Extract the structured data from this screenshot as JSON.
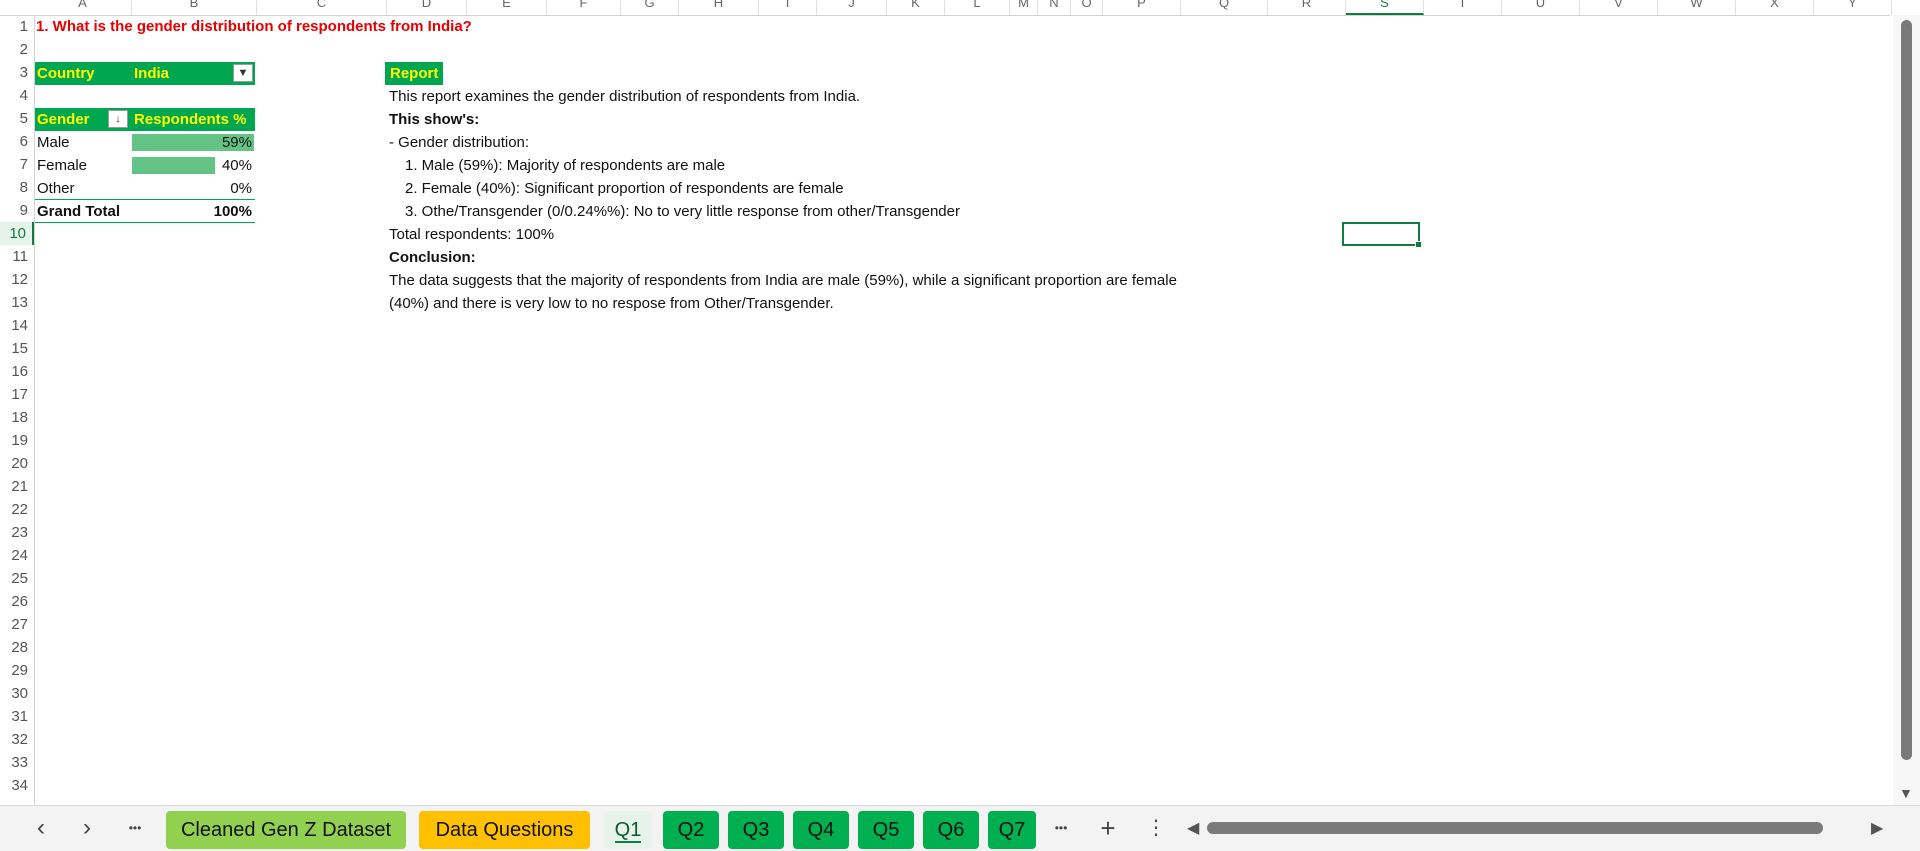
{
  "columns": [
    "A",
    "B",
    "C",
    "D",
    "E",
    "F",
    "G",
    "H",
    "I",
    "J",
    "K",
    "L",
    "M",
    "N",
    "O",
    "P",
    "Q",
    "R",
    "S",
    "T",
    "U",
    "V",
    "W",
    "X",
    "Y"
  ],
  "selected_column": "S",
  "rows": [
    "1",
    "2",
    "3",
    "4",
    "5",
    "6",
    "7",
    "8",
    "9",
    "10",
    "11",
    "12",
    "13",
    "14",
    "15",
    "16",
    "17",
    "18",
    "19",
    "20",
    "21",
    "22",
    "23",
    "24",
    "25",
    "26",
    "27",
    "28",
    "29",
    "30",
    "31",
    "32",
    "33",
    "34"
  ],
  "selected_row": "10",
  "sheet": {
    "question": "1. What is the gender distribution of respondents from India?",
    "filter": {
      "label": "Country",
      "value": "India"
    },
    "pivot": {
      "header_gender": "Gender",
      "header_pct": "Respondents %",
      "rows": [
        {
          "label": "Male",
          "value": "59%",
          "fill": 0.59
        },
        {
          "label": "Female",
          "value": "40%",
          "fill": 0.4
        },
        {
          "label": "Other",
          "value": "0%",
          "fill": 0
        }
      ],
      "total_label": "Grand Total",
      "total_value": "100%"
    },
    "report": {
      "title": "Report",
      "line1": "This report examines the gender distribution of respondents from India.",
      "shows_heading": "This show's:",
      "dist_heading": "- Gender distribution:",
      "item1": "1. Male (59%): Majority of respondents are male",
      "item2": "2. Female (40%): Significant proportion of respondents are female",
      "item3": "3. Othe/Transgender (0/0.24%%): No to very little response from other/Transgender",
      "total": "Total respondents: 100%",
      "conclusion_heading": "Conclusion:",
      "conclusion_line1": "The data suggests that the majority of respondents from India are male (59%), while a significant proportion are female",
      "conclusion_line2": "(40%) and there is very low to no respose from Other/Transgender."
    }
  },
  "tabs": {
    "prev": "‹",
    "next": "›",
    "more_left": "•••",
    "sheets": [
      "Cleaned Gen Z Dataset",
      "Data Questions",
      "Q1",
      "Q2",
      "Q3",
      "Q4",
      "Q5",
      "Q6",
      "Q7"
    ],
    "active": "Q1",
    "more_right": "•••",
    "add": "+",
    "options": "⋮"
  },
  "colors": {
    "header_green": "#00a650",
    "header_text": "#ffff00",
    "question_red": "#e60000",
    "databar": "#63c384",
    "tab_green": "#00b050",
    "tab_orange": "#ffc000",
    "tab_lightgreen": "#92d050"
  }
}
